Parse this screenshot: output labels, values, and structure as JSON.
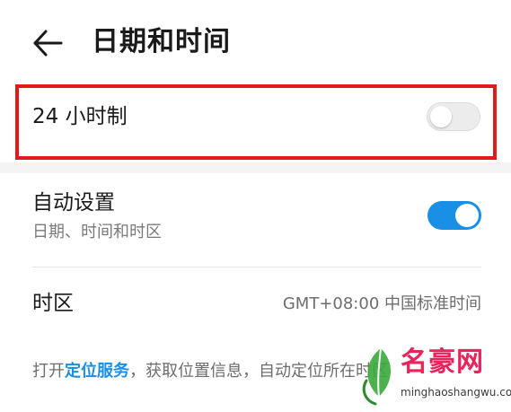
{
  "header": {
    "title": "日期和时间",
    "back_icon": "arrow-left-icon"
  },
  "hour24": {
    "label": "24 小时制",
    "enabled": false,
    "highlight_color": "#e11a1a"
  },
  "auto": {
    "title": "自动设置",
    "subtitle": "日期、时间和时区",
    "enabled": true,
    "toggle_color": "#1a8fe6"
  },
  "timezone": {
    "label": "时区",
    "value": "GMT+08:00 中国标准时间"
  },
  "note": {
    "prefix": "打开",
    "link": "定位服务",
    "suffix": "，获取位置信息，自动定位所在时区"
  },
  "watermark": {
    "name": "名豪网",
    "url": "minghaoshangwu.com"
  }
}
